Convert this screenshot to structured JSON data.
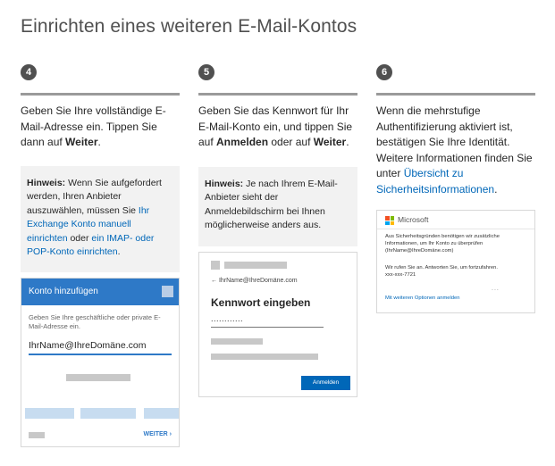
{
  "title": "Einrichten eines weiteren E-Mail-Kontos",
  "steps": [
    {
      "number": "4",
      "text_a": "Geben Sie Ihre vollständige E-Mail-Adresse ein. Tippen Sie dann auf ",
      "text_b": "Weiter",
      "text_c": ".",
      "note_label": "Hinweis:",
      "note_a": " Wenn Sie aufgefordert werden, Ihren Anbieter auszuwählen, müssen Sie ",
      "note_link1": "Ihr Exchange Konto manuell einrichten",
      "note_b": " oder ",
      "note_link2": "ein IMAP- oder POP-Konto einrichten",
      "note_c": "."
    },
    {
      "number": "5",
      "text_a": "Geben Sie das Kennwort für Ihr E-Mail-Konto ein, und tippen Sie auf ",
      "text_b": "Anmelden",
      "text_c": " oder auf ",
      "text_d": "Weiter",
      "text_e": ".",
      "note_label": "Hinweis:",
      "note_a": " Je nach Ihrem E-Mail-Anbieter sieht der Anmeldebildschirm bei Ihnen möglicherweise anders aus."
    },
    {
      "number": "6",
      "text_a": "Wenn die mehrstufige Authentifizierung aktiviert ist, bestätigen Sie Ihre Identität. Weitere Informationen finden Sie unter ",
      "link": "Übersicht zu Sicherheitsinformationen",
      "text_b": "."
    }
  ],
  "phone": {
    "header": "Konto hinzufügen",
    "subtitle": "Geben Sie Ihre geschäftliche oder private E-Mail-Adresse ein.",
    "input_value": "IhrName@IhreDomäne.com",
    "next_label": "WEITER",
    "next_arrow": "›"
  },
  "password_screen": {
    "back_arrow": "←",
    "email": "IhrName@IhreDomäne.com",
    "title": "Kennwort eingeben",
    "dots": "............",
    "button": "Anmelden"
  },
  "ms_auth": {
    "brand": "Microsoft",
    "text1": "Aus Sicherheitsgründen benötigen wir zusätzliche Informationen, um Ihr Konto zu überprüfen (IhrName@IhreDomäne.com)",
    "text2": "Wir rufen Sie an. Antworten Sie, um fortzufahren.",
    "phone": "xxx-xxx-7721",
    "link": "Mit weiteren Optionen anmelden",
    "dots": "...",
    "logo_colors": [
      "#f25022",
      "#7fba00",
      "#00a4ef",
      "#ffb900"
    ]
  }
}
